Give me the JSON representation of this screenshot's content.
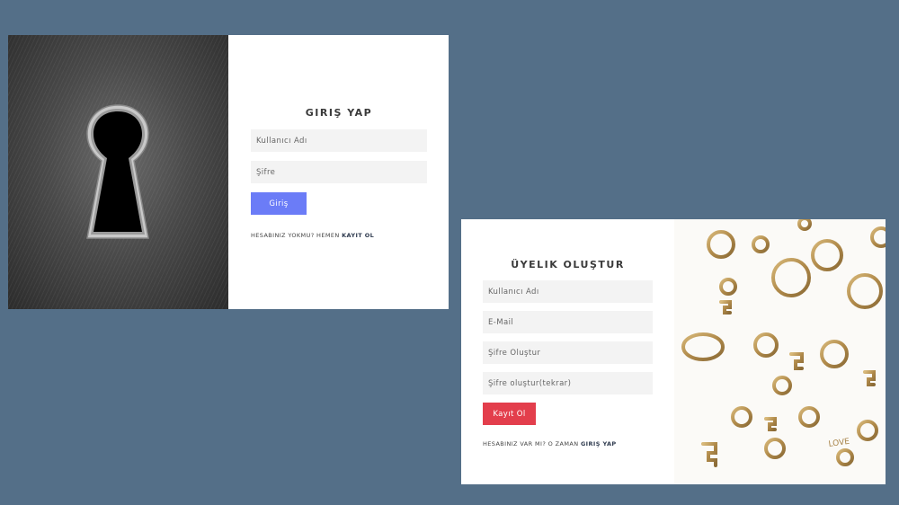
{
  "login": {
    "title": "GIRIŞ YAP",
    "username_placeholder": "Kullanıcı Adı",
    "password_placeholder": "Şifre",
    "submit_label": "Giriş",
    "footer_text": "HESABINIZ YOKMU? HEMEN",
    "footer_link": "KAYIT OL",
    "button_color": "#6b7cf7"
  },
  "register": {
    "title": "ÜYELIK OLUŞTUR",
    "username_placeholder": "Kullanıcı Adı",
    "email_placeholder": "E-Mail",
    "password_placeholder": "Şifre Oluştur",
    "password_repeat_placeholder": "Şifre oluştur(tekrar)",
    "submit_label": "Kayıt Ol",
    "footer_text": "HESABINIZ VAR MI? O ZAMAN",
    "footer_link": "GIRIŞ YAP",
    "button_color": "#e33e4c"
  },
  "colors": {
    "background": "#546f88",
    "card": "#ffffff",
    "input_bg": "#f3f3f3"
  },
  "images": {
    "login_art": "keyhole-illustration",
    "register_art": "antique-keys-illustration"
  }
}
